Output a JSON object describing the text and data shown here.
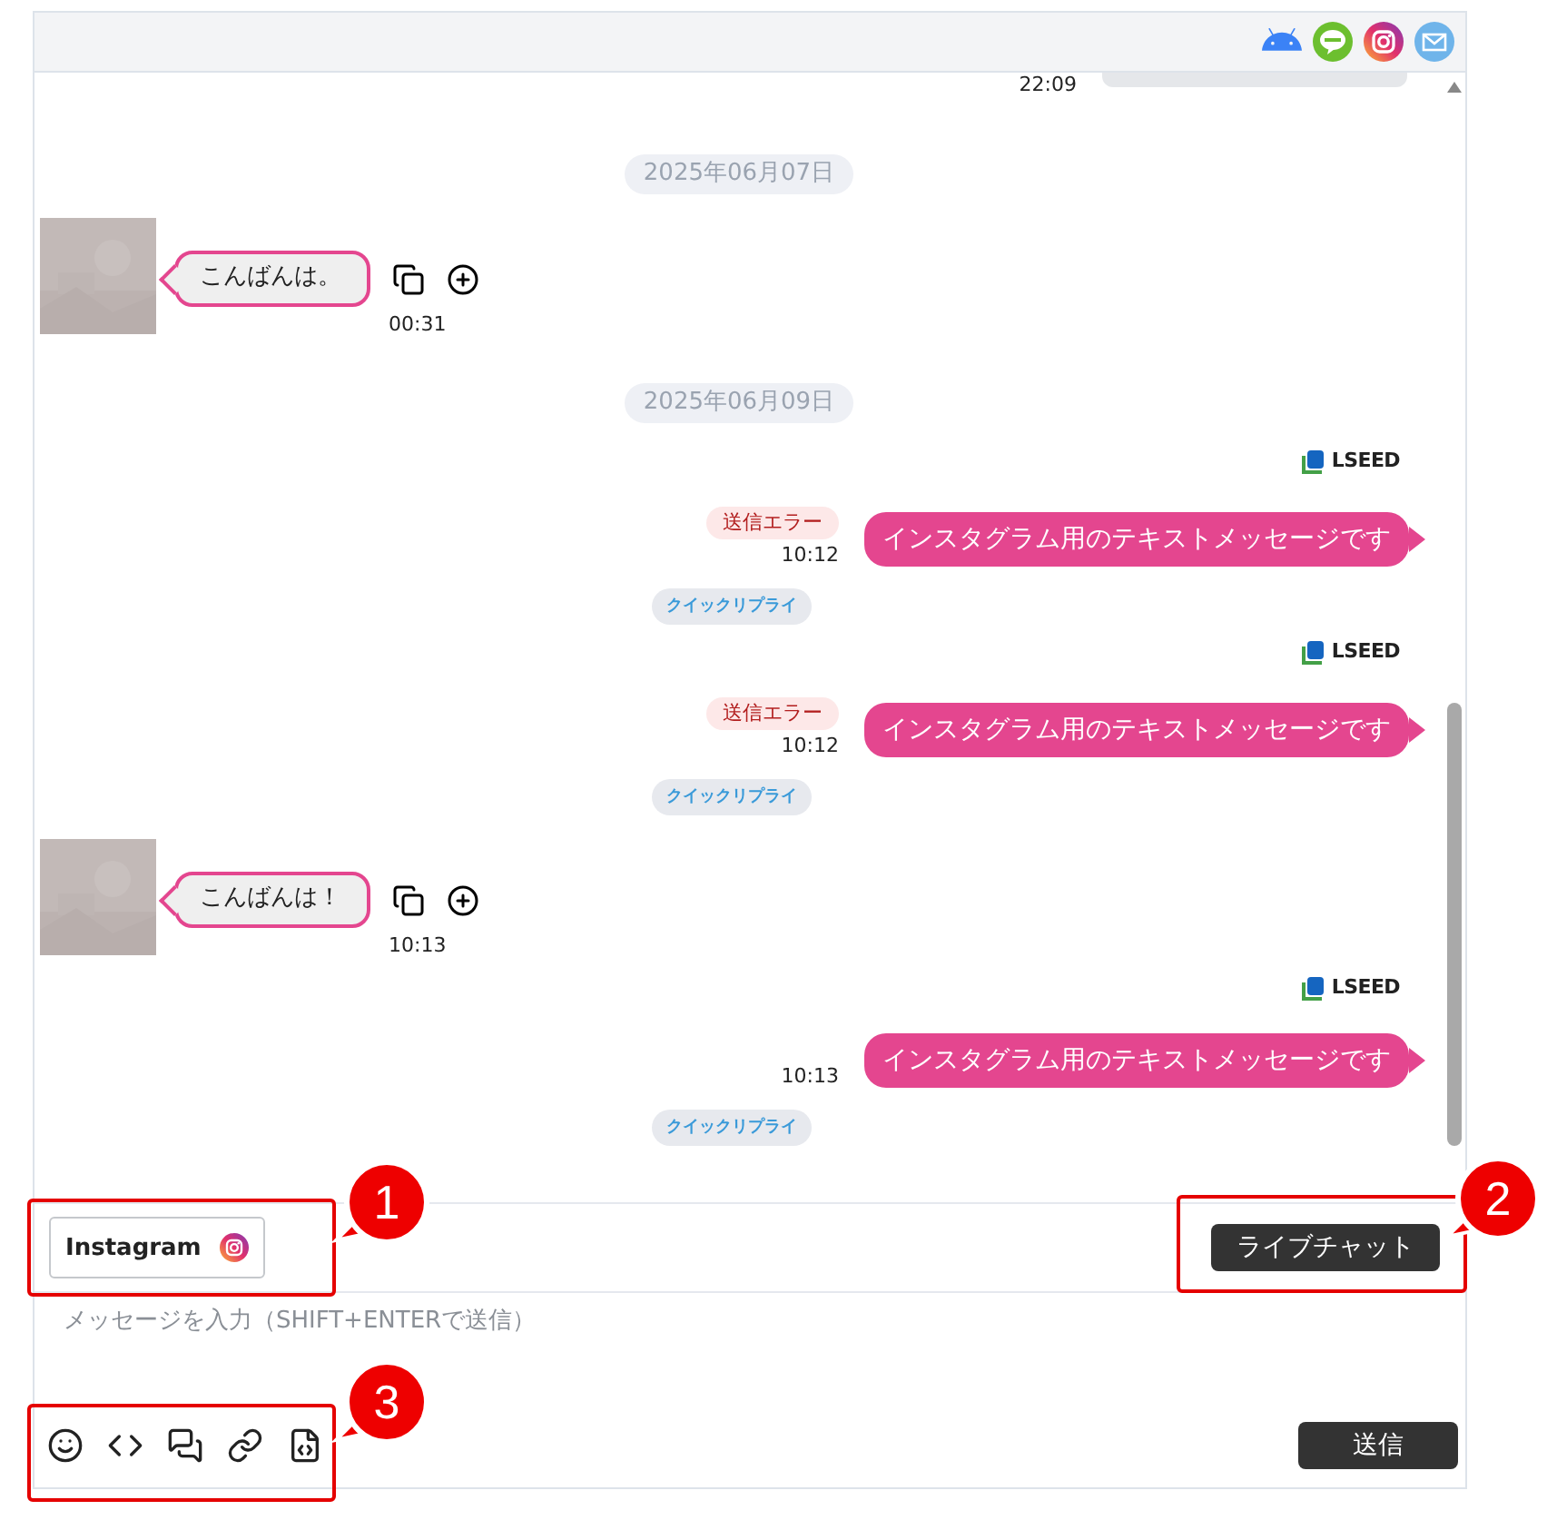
{
  "messages": [
    {
      "kind": "partial",
      "time": "22:09"
    },
    {
      "kind": "date",
      "text": "2025年06月07日"
    },
    {
      "kind": "incoming",
      "text": "こんばんは。",
      "time": "00:31"
    },
    {
      "kind": "date",
      "text": "2025年06月09日"
    },
    {
      "kind": "brand",
      "text": "LSEED"
    },
    {
      "kind": "outgoing",
      "text": "インスタグラム用のテキストメッセージです",
      "time": "10:12",
      "error": "送信エラー"
    },
    {
      "kind": "quick_reply",
      "text": "クイックリプライ"
    },
    {
      "kind": "brand",
      "text": "LSEED"
    },
    {
      "kind": "outgoing",
      "text": "インスタグラム用のテキストメッセージです",
      "time": "10:12",
      "error": "送信エラー"
    },
    {
      "kind": "quick_reply",
      "text": "クイックリプライ"
    },
    {
      "kind": "incoming",
      "text": "こんばんは！",
      "time": "10:13"
    },
    {
      "kind": "brand",
      "text": "LSEED"
    },
    {
      "kind": "outgoing",
      "text": "インスタグラム用のテキストメッセージです",
      "time": "10:13"
    },
    {
      "kind": "quick_reply",
      "text": "クイックリプライ"
    }
  ],
  "channel_button": {
    "label": "Instagram"
  },
  "live_chat_button": {
    "label": "ライブチャット"
  },
  "composer": {
    "placeholder": "メッセージを入力（SHIFT+ENTERで送信）"
  },
  "send_button": {
    "label": "送信"
  },
  "callouts": [
    {
      "number": "1"
    },
    {
      "number": "2"
    },
    {
      "number": "3"
    }
  ]
}
